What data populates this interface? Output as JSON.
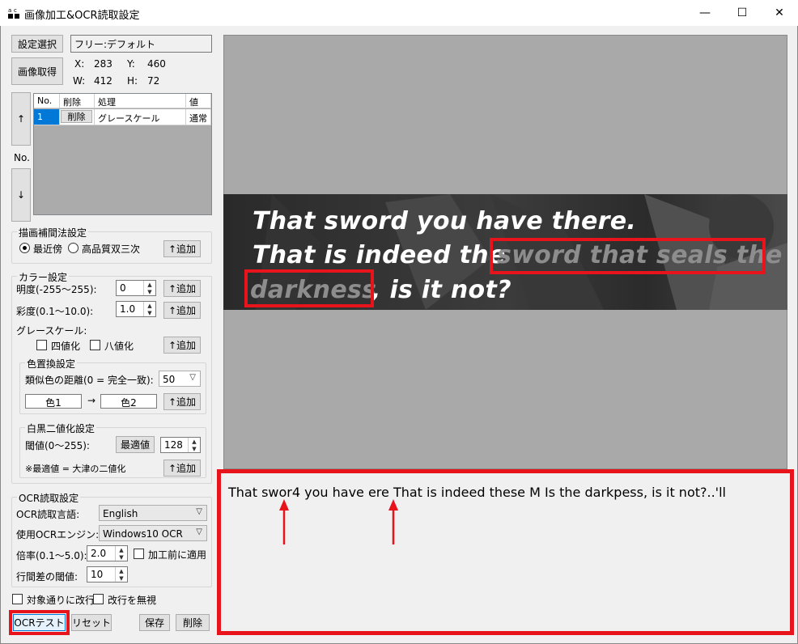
{
  "window": {
    "title": "画像加工&OCR読取設定",
    "controls": [
      "—",
      "☐",
      "✕"
    ]
  },
  "left": {
    "setting_select_button": "設定選択",
    "setting_name": "フリー:デフォルト",
    "capture_button": "画像取得",
    "coords": {
      "x_label": "X:",
      "x": "283",
      "y_label": "Y:",
      "y": "460",
      "w_label": "W:",
      "w": "412",
      "h_label": "H:",
      "h": "72"
    },
    "up_button": "↑",
    "no_label": "No.",
    "down_button": "↓",
    "table": {
      "headers": [
        "No.",
        "削除",
        "処理",
        "値"
      ],
      "rows": [
        {
          "no": "1",
          "delete": "削除",
          "process": "グレースケール",
          "value": "通常"
        }
      ]
    },
    "interpolation": {
      "title": "描画補間法設定",
      "option1": "最近傍",
      "option2": "高品質双三次",
      "add": "↑追加"
    },
    "color": {
      "title": "カラー設定",
      "brightness_label": "明度(-255～255):",
      "brightness": "0",
      "add1": "↑追加",
      "saturation_label": "彩度(0.1～10.0):",
      "saturation": "1.0",
      "add2": "↑追加",
      "gray_label": "グレースケール:",
      "four_level": "四値化",
      "eight_level": "八値化",
      "add3": "↑追加",
      "replace": {
        "title": "色置換設定",
        "distance_label": "類似色の距離(0 = 完全一致):",
        "distance": "50",
        "color1": "色1",
        "arrow": "→",
        "color2": "色2",
        "add": "↑追加"
      },
      "binary": {
        "title": "白黒二値化設定",
        "threshold_label": "閾値(0～255):",
        "optimal_button": "最適値",
        "threshold": "128",
        "note": "※最適値 = 大津の二値化",
        "add": "↑追加"
      }
    },
    "ocr": {
      "title": "OCR読取設定",
      "lang_label": "OCR読取言語:",
      "lang": "English",
      "engine_label": "使用OCRエンジン:",
      "engine": "Windows10 OCR",
      "scale_label": "倍率(0.1～5.0):",
      "scale": "2.0",
      "apply_before": "加工前に適用",
      "line_gap_label": "行間差の閾値:",
      "line_gap": "10"
    },
    "newline_by_target": "対象通りに改行",
    "ignore_newline": "改行を無視",
    "ocr_test_button": "OCRテスト",
    "reset_button": "リセット",
    "save_button": "保存",
    "delete_button": "削除"
  },
  "preview": {
    "line1": "That sword you have there.",
    "line2a": "That is indeed the ",
    "line2b": "sword that seals the",
    "line3a": "darkness",
    "line3b": ", is it not?"
  },
  "result": {
    "text": "That swor4 you have ere That is indeed these M Is the darkpess, is it not?..'ll"
  },
  "colors": {
    "highlight_red": "#e8141b",
    "preview_bg": "#a9a9a9"
  }
}
